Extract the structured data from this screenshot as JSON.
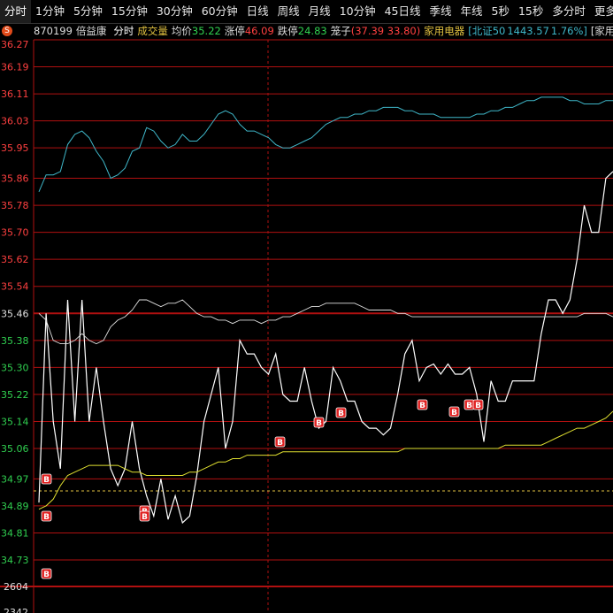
{
  "toolbar": {
    "items": [
      "分时",
      "1分钟",
      "5分钟",
      "15分钟",
      "30分钟",
      "60分钟",
      "日线",
      "周线",
      "月线",
      "10分钟",
      "45日线",
      "季线",
      "年线",
      "5秒",
      "15秒",
      "多分时",
      "更多"
    ],
    "more_arrow": ">"
  },
  "header_badge": "S",
  "info": {
    "code": "870199",
    "name": "倍益康",
    "mode": "分时",
    "volume_label": "成交量",
    "avg_label": "均价",
    "avg_value": "35.22",
    "limit_up_label": "涨停",
    "limit_up_value": "46.09",
    "limit_down_label": "跌停",
    "limit_down_value": "24.83",
    "cage_label": "笼子",
    "cage_value": "(37.39 33.80)",
    "sector": "家用电器",
    "index_label": "[北证50",
    "index_value": "1443.57",
    "index_change": "1.76%]",
    "extra": "[家用"
  },
  "price_axis": [
    "36.27",
    "36.19",
    "36.11",
    "36.03",
    "35.95",
    "35.86",
    "35.78",
    "35.70",
    "35.62",
    "35.54",
    "35.46",
    "35.38",
    "35.30",
    "35.22",
    "35.14",
    "35.06",
    "34.97",
    "34.89",
    "34.81",
    "34.73"
  ],
  "volume_axis_label": "2604",
  "bottom_partial_label": "2342",
  "colors": {
    "grid": "#b01010",
    "price": "#ffffff",
    "avg": "#e0e030",
    "index": "#3fb7c9",
    "up": "#ff4040",
    "down": "#30d050",
    "neutral": "#e0e0e0"
  },
  "markers": [
    "B",
    "B",
    "B",
    "B",
    "B",
    "B",
    "B",
    "B",
    "B",
    "B",
    "B",
    "B"
  ],
  "chart_data": {
    "type": "line",
    "y_range": [
      34.73,
      36.27
    ],
    "reference_price": 35.46,
    "series": [
      {
        "values": [
          34.9,
          35.46,
          35.14,
          35.0,
          35.5,
          35.14,
          35.5,
          35.14,
          35.3,
          35.14,
          35.0,
          34.95,
          35.0,
          35.14,
          35.0,
          34.92,
          34.86,
          34.97,
          34.85,
          34.92,
          34.84,
          34.86,
          34.98,
          35.14,
          35.22,
          35.3,
          35.06,
          35.14,
          35.38,
          35.34,
          35.34,
          35.3,
          35.28,
          35.34,
          35.22,
          35.2,
          35.2,
          35.3,
          35.2,
          35.12,
          35.14,
          35.3,
          35.26,
          35.2,
          35.2,
          35.14,
          35.12,
          35.12,
          35.1,
          35.12,
          35.22,
          35.34,
          35.38,
          35.26,
          35.3,
          35.31,
          35.28,
          35.31,
          35.28,
          35.28,
          35.3,
          35.22,
          35.08,
          35.26,
          35.2,
          35.2,
          35.26,
          35.26,
          35.26,
          35.26,
          35.4,
          35.5,
          35.5,
          35.46,
          35.5,
          35.62,
          35.78,
          35.7,
          35.7,
          35.86,
          35.88
        ]
      },
      {
        "values": [
          35.46,
          35.44,
          35.38,
          35.37,
          35.37,
          35.38,
          35.4,
          35.38,
          35.37,
          35.38,
          35.42,
          35.44,
          35.45,
          35.47,
          35.5,
          35.5,
          35.49,
          35.48,
          35.49,
          35.49,
          35.5,
          35.48,
          35.46,
          35.45,
          35.45,
          35.44,
          35.44,
          35.43,
          35.44,
          35.44,
          35.44,
          35.43,
          35.44,
          35.44,
          35.45,
          35.45,
          35.46,
          35.47,
          35.48,
          35.48,
          35.49,
          35.49,
          35.49,
          35.49,
          35.49,
          35.48,
          35.47,
          35.47,
          35.47,
          35.47,
          35.46,
          35.46,
          35.45,
          35.45,
          35.45,
          35.45,
          35.45,
          35.45,
          35.45,
          35.45,
          35.45,
          35.45,
          35.45,
          35.45,
          35.45,
          35.45,
          35.45,
          35.45,
          35.45,
          35.45,
          35.45,
          35.45,
          35.45,
          35.45,
          35.45,
          35.45,
          35.46,
          35.46,
          35.46,
          35.46,
          35.45
        ]
      },
      {
        "values": [
          34.88,
          34.89,
          34.91,
          34.95,
          34.98,
          34.99,
          35.0,
          35.01,
          35.01,
          35.01,
          35.01,
          35.01,
          35.0,
          34.99,
          34.99,
          34.98,
          34.98,
          34.98,
          34.98,
          34.98,
          34.98,
          34.99,
          34.99,
          35.0,
          35.01,
          35.02,
          35.02,
          35.03,
          35.03,
          35.04,
          35.04,
          35.04,
          35.04,
          35.04,
          35.05,
          35.05,
          35.05,
          35.05,
          35.05,
          35.05,
          35.05,
          35.05,
          35.05,
          35.05,
          35.05,
          35.05,
          35.05,
          35.05,
          35.05,
          35.05,
          35.05,
          35.06,
          35.06,
          35.06,
          35.06,
          35.06,
          35.06,
          35.06,
          35.06,
          35.06,
          35.06,
          35.06,
          35.06,
          35.06,
          35.06,
          35.07,
          35.07,
          35.07,
          35.07,
          35.07,
          35.07,
          35.08,
          35.09,
          35.1,
          35.11,
          35.12,
          35.12,
          35.13,
          35.14,
          35.15,
          35.17
        ]
      },
      {
        "values": [
          35.82,
          35.87,
          35.87,
          35.88,
          35.96,
          35.99,
          36.0,
          35.98,
          35.94,
          35.91,
          35.86,
          35.87,
          35.89,
          35.94,
          35.95,
          36.01,
          36.0,
          35.97,
          35.95,
          35.96,
          35.99,
          35.97,
          35.97,
          35.99,
          36.02,
          36.05,
          36.06,
          36.05,
          36.02,
          36.0,
          36.0,
          35.99,
          35.98,
          35.96,
          35.95,
          35.95,
          35.96,
          35.97,
          35.98,
          36.0,
          36.02,
          36.03,
          36.04,
          36.04,
          36.05,
          36.05,
          36.06,
          36.06,
          36.07,
          36.07,
          36.07,
          36.06,
          36.06,
          36.05,
          36.05,
          36.05,
          36.04,
          36.04,
          36.04,
          36.04,
          36.04,
          36.05,
          36.05,
          36.06,
          36.06,
          36.07,
          36.07,
          36.08,
          36.09,
          36.09,
          36.1,
          36.1,
          36.1,
          36.1,
          36.09,
          36.09,
          36.08,
          36.08,
          36.08,
          36.09,
          36.09
        ]
      }
    ]
  }
}
